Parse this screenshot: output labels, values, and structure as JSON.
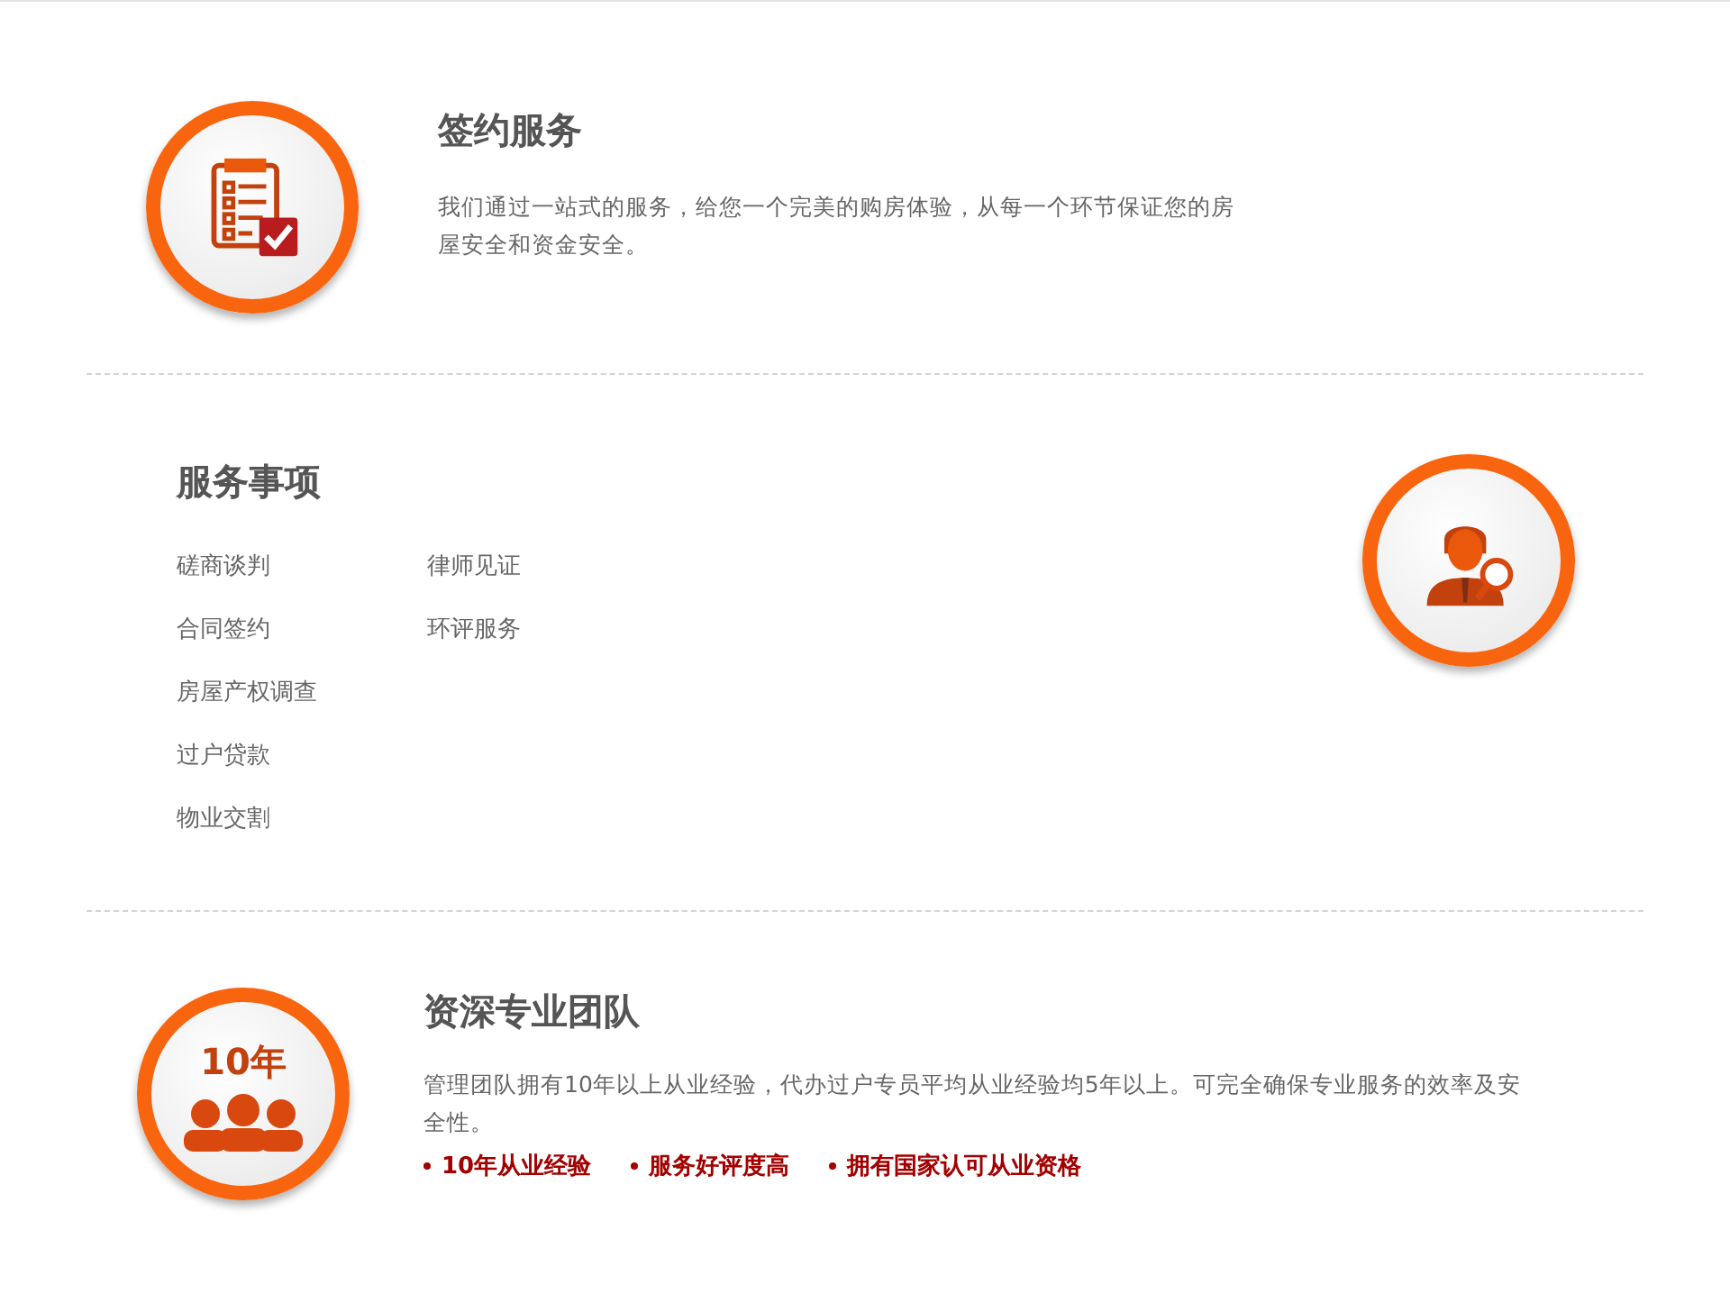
{
  "sections": [
    {
      "kind": "intro",
      "title": "签约服务",
      "description": "我们通过一站式的服务，给您一个完美的购房体验，从每一个环节保证您的房屋安全和资金安全。"
    },
    {
      "kind": "list",
      "title": "服务事项",
      "columns": [
        [
          "磋商谈判",
          "合同签约",
          "房屋产权调查",
          "过户贷款",
          "物业交割"
        ],
        [
          "律师见证",
          "环评服务"
        ]
      ]
    },
    {
      "kind": "intro",
      "icon_text": "10年",
      "title": "资深专业团队",
      "description": "管理团队拥有10年以上从业经验，代办过户专员平均从业经验均5年以上。可完全确保专业服务的效率及安全性。",
      "highlights": [
        "10年从业经验",
        "服务好评度高",
        "拥有国家认可从业资格"
      ]
    }
  ]
}
